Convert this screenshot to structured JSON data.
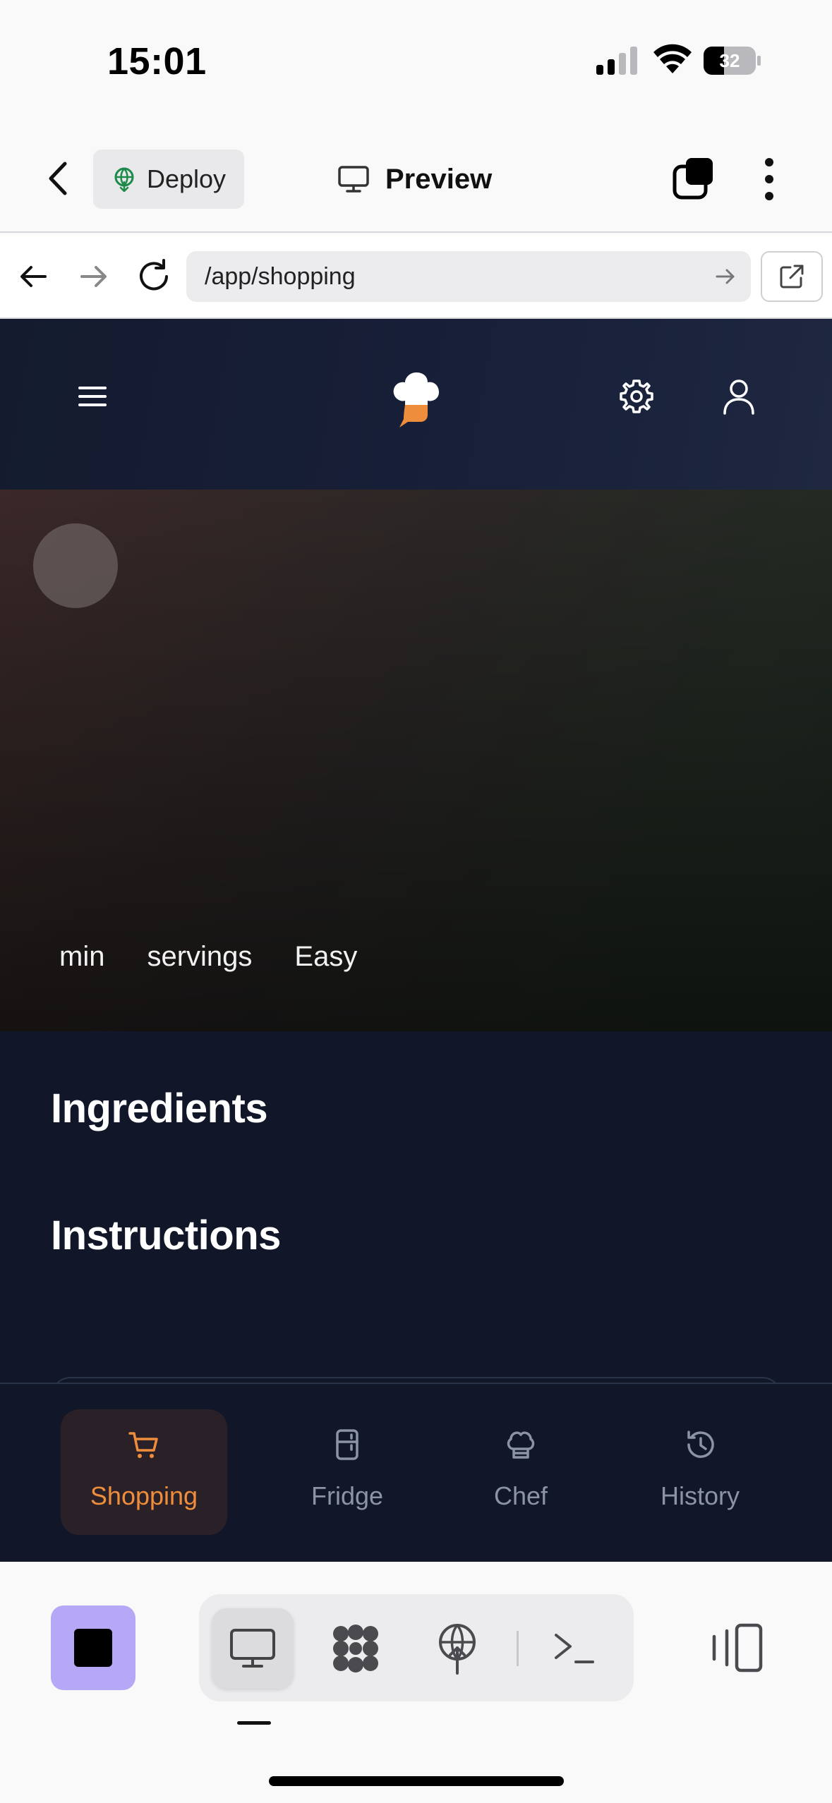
{
  "status_bar": {
    "time": "15:01",
    "battery": "32"
  },
  "app_bar": {
    "deploy_label": "Deploy",
    "title": "Preview"
  },
  "browser": {
    "url": "/app/shopping"
  },
  "hero": {
    "meta": [
      "min",
      "servings",
      "Easy"
    ]
  },
  "recipe": {
    "ingredients_heading": "Ingredients",
    "instructions_heading": "Instructions"
  },
  "tabs": [
    {
      "label": "Shopping",
      "icon": "cart-icon",
      "active": true
    },
    {
      "label": "Fridge",
      "icon": "fridge-icon",
      "active": false
    },
    {
      "label": "Chef",
      "icon": "chef-hat-icon",
      "active": false
    },
    {
      "label": "History",
      "icon": "history-icon",
      "active": false
    }
  ],
  "colors": {
    "accent": "#ee8d3c",
    "stop_button": "#b7a8f7",
    "page_bg": "#111729"
  }
}
